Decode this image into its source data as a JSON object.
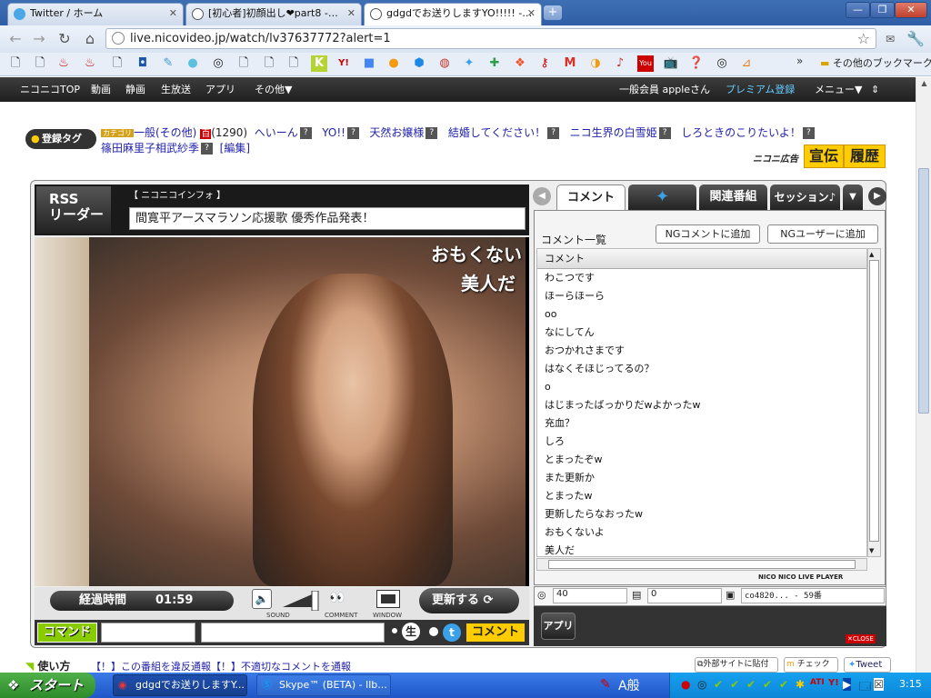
{
  "browser": {
    "tabs": [
      {
        "label": "Twitter / ホーム",
        "icon": "twitter-bird-icon"
      },
      {
        "label": "[初心者]初顔出し❤part8 -…",
        "icon": "nico-tv-icon"
      },
      {
        "label": "gdgdでお送りしますYO!!!!! -…",
        "icon": "nico-tv-icon"
      }
    ],
    "url": "live.nicovideo.jp/watch/lv37637772?alert=1",
    "other_bookmarks": "その他のブックマーク"
  },
  "nico_nav": {
    "items": [
      "ニコニコTOP",
      "動画",
      "静画",
      "生放送",
      "アプリ",
      "その他▼"
    ],
    "user": "一般会員 appleさん",
    "premium": "プレミアム登録",
    "menu": "メニュー▼"
  },
  "tags": {
    "label": "登録タグ",
    "category_badge": "カテゴリ",
    "first_tag": "一般(その他)",
    "hyaku": "百",
    "count": "(1290)",
    "items": [
      "へいーん",
      "YO!!",
      "天然お嬢様",
      "結婚してください！",
      "ニコ生界の白雪姫",
      "しろときのこりたいよ！",
      "篠田麻里子相武紗季"
    ],
    "edit": "[編集]",
    "senden": "宣伝",
    "rireki": "履歴"
  },
  "player": {
    "rss_label": "RSS\nリーダー",
    "info_header": "【 ニコニコインフォ 】",
    "info_text": "間寛平アースマラソン応援歌 優秀作品発表！",
    "overlay_comments": [
      "おもくない",
      "美人だ"
    ],
    "elapsed_label": "経過時間",
    "elapsed_time": "01:59",
    "sound_label": "SOUND",
    "comment_label": "COMMENT",
    "window_label": "WINDOW",
    "refresh_label": "更新する",
    "command_label": "コマンド",
    "comment_button": "コメント",
    "usage": "使い方",
    "report1": "【！】この番組を違反通報",
    "report2": "【！】不適切なコメントを通報",
    "share": "外部サイトに貼付",
    "check": "チェック",
    "tweet": "Tweet"
  },
  "comment_panel": {
    "tabs": [
      "コメント",
      "関連番組",
      "セッション♪"
    ],
    "list_title": "コメント一覧",
    "ng_comment": "NGコメントに追加",
    "ng_user": "NGユーザーに追加",
    "col_header": "コメント",
    "comments": [
      "わこつです",
      "ほーらほーら",
      "oo",
      "なにしてん",
      "おつかれさまです",
      "はなくそほじってるの？",
      "o",
      "はじまったばっかりだwよかったw",
      "充血？",
      "しろ",
      "とまったぞw",
      "また更新か",
      "とまったw",
      "更新したらなおったw",
      "おもくないよ",
      "美人だ"
    ],
    "brand": "NICO NICO LIVE PLAYER",
    "viewers": "40",
    "comment_count": "0",
    "community": "co4820... - 59番",
    "app_label": "アプリ",
    "close": "CLOSE"
  },
  "taskbar": {
    "start": "スタート",
    "items": [
      "gdgdでお送りしますY...",
      "Skype™ (BETA) - llb..."
    ],
    "ime": "A般",
    "clock": "3:15"
  }
}
